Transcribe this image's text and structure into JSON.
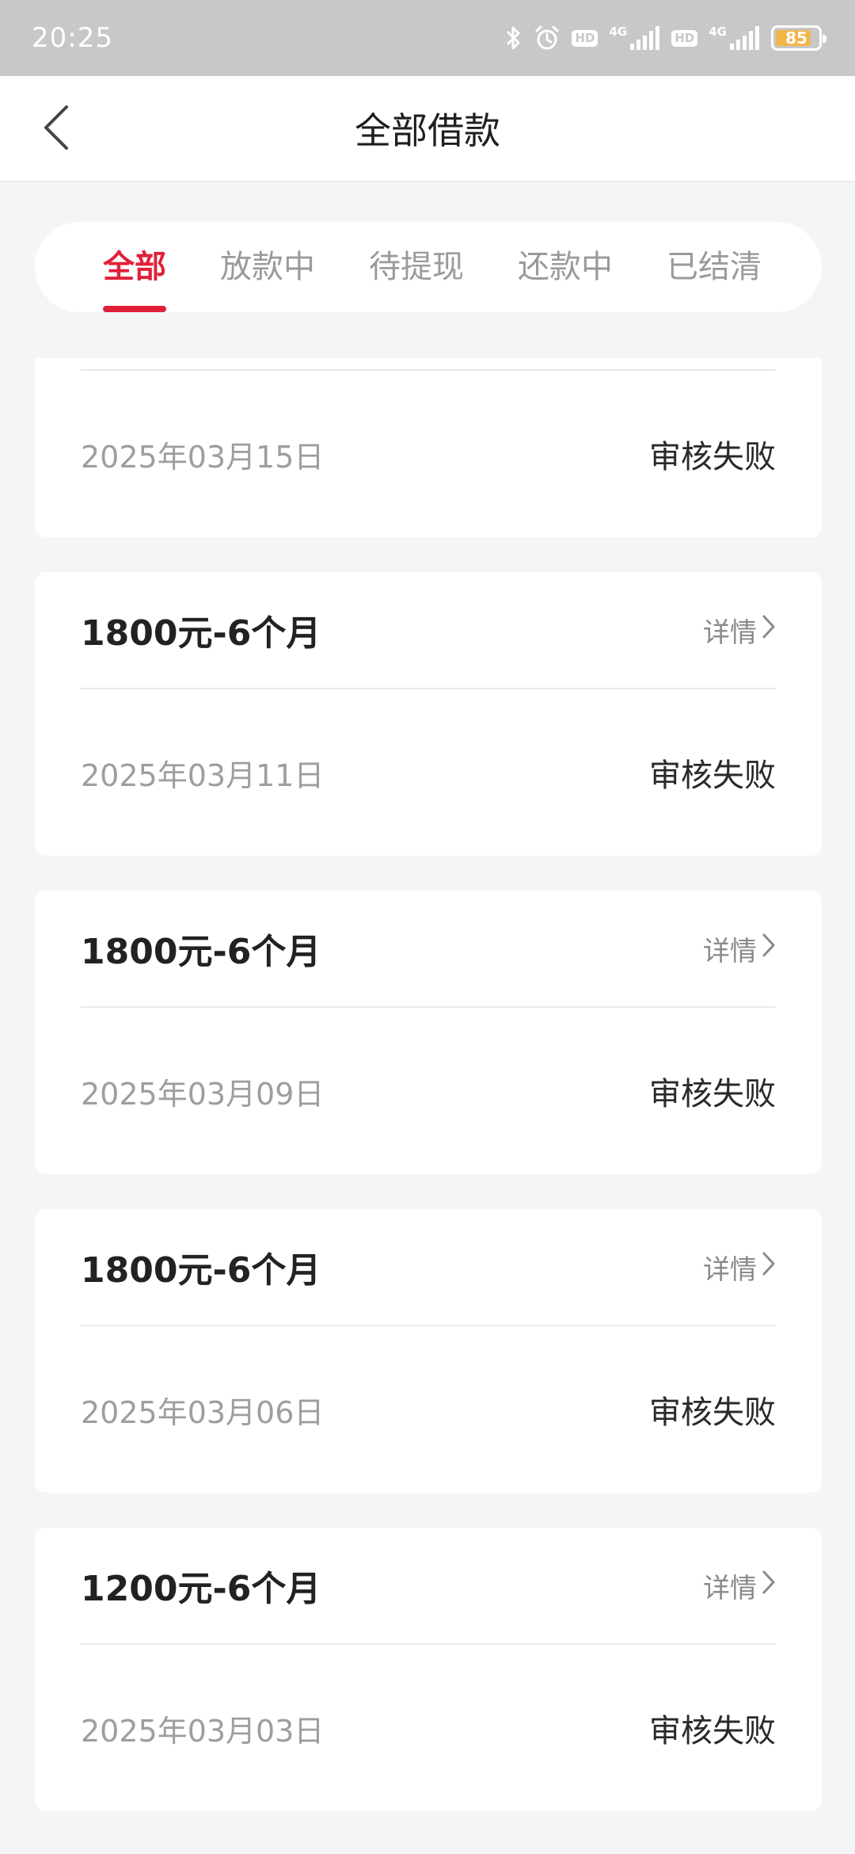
{
  "status_bar": {
    "time": "20:25",
    "network_1": "4G",
    "network_2": "4G",
    "hd_1": "HD",
    "hd_2": "HD",
    "battery": "85",
    "battery_level": 0.85
  },
  "header": {
    "title": "全部借款",
    "back_icon": "chevron-left-icon"
  },
  "tabs": [
    {
      "label": "全部",
      "active": true
    },
    {
      "label": "放款中",
      "active": false
    },
    {
      "label": "待提现",
      "active": false
    },
    {
      "label": "还款中",
      "active": false
    },
    {
      "label": "已结清",
      "active": false
    }
  ],
  "loans": [
    {
      "amount": "",
      "detail_label": "",
      "date": "2025年03月15日",
      "status": "审核失败"
    },
    {
      "amount": "1800元-6个月",
      "detail_label": "详情",
      "date": "2025年03月11日",
      "status": "审核失败"
    },
    {
      "amount": "1800元-6个月",
      "detail_label": "详情",
      "date": "2025年03月09日",
      "status": "审核失败"
    },
    {
      "amount": "1800元-6个月",
      "detail_label": "详情",
      "date": "2025年03月06日",
      "status": "审核失败"
    },
    {
      "amount": "1200元-6个月",
      "detail_label": "详情",
      "date": "2025年03月03日",
      "status": "审核失败"
    }
  ],
  "colors": {
    "accent": "#e0213a",
    "background": "#f4f5f7",
    "status_bar": "#c8c8c8"
  }
}
